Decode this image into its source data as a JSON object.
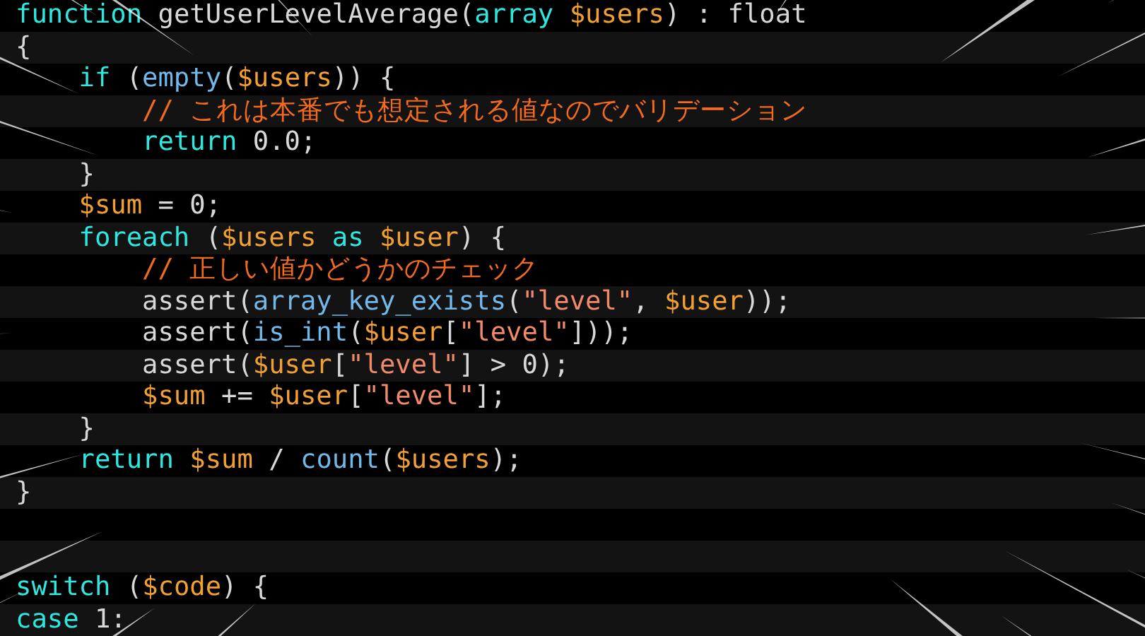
{
  "code_lines": [
    {
      "kind": "code",
      "tokens": [
        {
          "kind": "keyword",
          "text": "function"
        },
        {
          "kind": "plain",
          "text": " getUserLevelAverage("
        },
        {
          "kind": "keyword",
          "text": "array"
        },
        {
          "kind": "variable",
          "text": " $users"
        },
        {
          "kind": "plain",
          "text": ") : float"
        }
      ]
    },
    {
      "kind": "code",
      "tokens": [
        {
          "kind": "plain",
          "text": "{"
        }
      ],
      "children": [
        {
          "kind": "code",
          "tokens": [
            {
              "kind": "keyword",
              "text": "if"
            },
            {
              "kind": "plain",
              "text": " ("
            },
            {
              "kind": "call",
              "text": "empty"
            },
            {
              "kind": "plain",
              "text": "("
            },
            {
              "kind": "variable",
              "text": "$users"
            },
            {
              "kind": "plain",
              "text": ")) {"
            }
          ],
          "children": [
            {
              "kind": "code",
              "tokens": [
                {
                  "kind": "comment",
                  "text": "// これは本番でも想定される値なのでバリデーション"
                }
              ]
            },
            {
              "kind": "code",
              "tokens": [
                {
                  "kind": "keyword",
                  "text": "return"
                },
                {
                  "kind": "plain",
                  "text": " 0.0;"
                }
              ]
            }
          ]
        },
        {
          "kind": "code",
          "tokens": [
            {
              "kind": "plain",
              "text": "}"
            }
          ]
        },
        {
          "kind": "code",
          "tokens": [
            {
              "kind": "variable",
              "text": "$sum"
            },
            {
              "kind": "plain",
              "text": " = 0;"
            }
          ]
        },
        {
          "kind": "code",
          "tokens": [
            {
              "kind": "keyword",
              "text": "foreach"
            },
            {
              "kind": "plain",
              "text": " ("
            },
            {
              "kind": "variable",
              "text": "$users"
            },
            {
              "kind": "keyword",
              "text": " as"
            },
            {
              "kind": "variable",
              "text": " $user"
            },
            {
              "kind": "plain",
              "text": ") {"
            }
          ],
          "children": [
            {
              "kind": "code",
              "tokens": [
                {
                  "kind": "comment",
                  "text": "// 正しい値かどうかのチェック"
                }
              ]
            },
            {
              "kind": "code",
              "tokens": [
                {
                  "kind": "plain",
                  "text": "assert("
                },
                {
                  "kind": "call",
                  "text": "array_key_exists"
                },
                {
                  "kind": "plain",
                  "text": "("
                },
                {
                  "kind": "string",
                  "text": "\"level\""
                },
                {
                  "kind": "plain",
                  "text": ", "
                },
                {
                  "kind": "variable",
                  "text": "$user"
                },
                {
                  "kind": "plain",
                  "text": "));"
                }
              ]
            },
            {
              "kind": "code",
              "tokens": [
                {
                  "kind": "plain",
                  "text": "assert("
                },
                {
                  "kind": "call",
                  "text": "is_int"
                },
                {
                  "kind": "plain",
                  "text": "("
                },
                {
                  "kind": "variable",
                  "text": "$user"
                },
                {
                  "kind": "plain",
                  "text": "["
                },
                {
                  "kind": "string",
                  "text": "\"level\""
                },
                {
                  "kind": "plain",
                  "text": "]));"
                }
              ]
            },
            {
              "kind": "code",
              "tokens": [
                {
                  "kind": "plain",
                  "text": "assert("
                },
                {
                  "kind": "variable",
                  "text": "$user"
                },
                {
                  "kind": "plain",
                  "text": "["
                },
                {
                  "kind": "string",
                  "text": "\"level\""
                },
                {
                  "kind": "plain",
                  "text": "] > 0);"
                }
              ]
            },
            {
              "kind": "code",
              "tokens": [
                {
                  "kind": "variable",
                  "text": "$sum"
                },
                {
                  "kind": "plain",
                  "text": " += "
                },
                {
                  "kind": "variable",
                  "text": "$user"
                },
                {
                  "kind": "plain",
                  "text": "["
                },
                {
                  "kind": "string",
                  "text": "\"level\""
                },
                {
                  "kind": "plain",
                  "text": "];"
                }
              ]
            }
          ]
        },
        {
          "kind": "code",
          "tokens": [
            {
              "kind": "plain",
              "text": "}"
            }
          ]
        },
        {
          "kind": "code",
          "tokens": [
            {
              "kind": "keyword",
              "text": "return"
            },
            {
              "kind": "variable",
              "text": " $sum"
            },
            {
              "kind": "plain",
              "text": " / "
            },
            {
              "kind": "call",
              "text": "count"
            },
            {
              "kind": "plain",
              "text": "("
            },
            {
              "kind": "variable",
              "text": "$users"
            },
            {
              "kind": "plain",
              "text": ");"
            }
          ]
        }
      ]
    },
    {
      "kind": "code",
      "tokens": [
        {
          "kind": "plain",
          "text": "}"
        }
      ]
    },
    {
      "kind": "blank"
    },
    {
      "kind": "blank"
    },
    {
      "kind": "code",
      "tokens": [
        {
          "kind": "keyword",
          "text": "switch"
        },
        {
          "kind": "plain",
          "text": " ("
        },
        {
          "kind": "variable",
          "text": "$code"
        },
        {
          "kind": "plain",
          "text": ") {"
        }
      ]
    },
    {
      "kind": "code",
      "tokens": [
        {
          "kind": "keyword",
          "text": "case"
        },
        {
          "kind": "plain",
          "text": " 1:"
        }
      ]
    }
  ]
}
